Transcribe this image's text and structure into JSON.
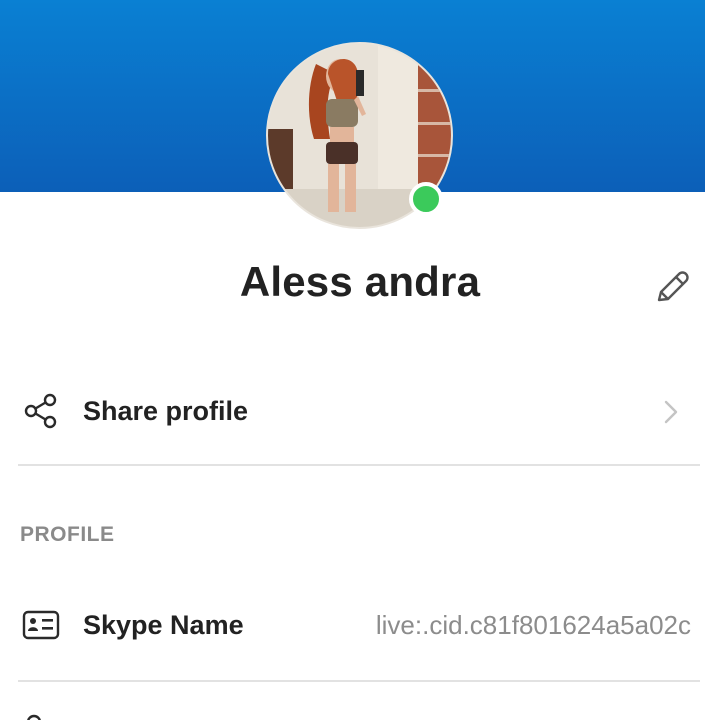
{
  "profile": {
    "display_name": "Aless andra",
    "presence_status": "online",
    "presence_color": "#3bca5b"
  },
  "header": {
    "gradient_top": "#0a80d3",
    "gradient_bottom": "#0c5fb8"
  },
  "actions": {
    "share_label": "Share profile"
  },
  "sections": {
    "profile_header": "PROFILE",
    "skype_name_label": "Skype Name",
    "skype_name_value": "live:.cid.c81f801624a5a02c"
  },
  "icons": {
    "edit": "pencil-icon",
    "share": "share-icon",
    "chevron": "chevron-right-icon",
    "contact_card": "contact-card-icon"
  }
}
